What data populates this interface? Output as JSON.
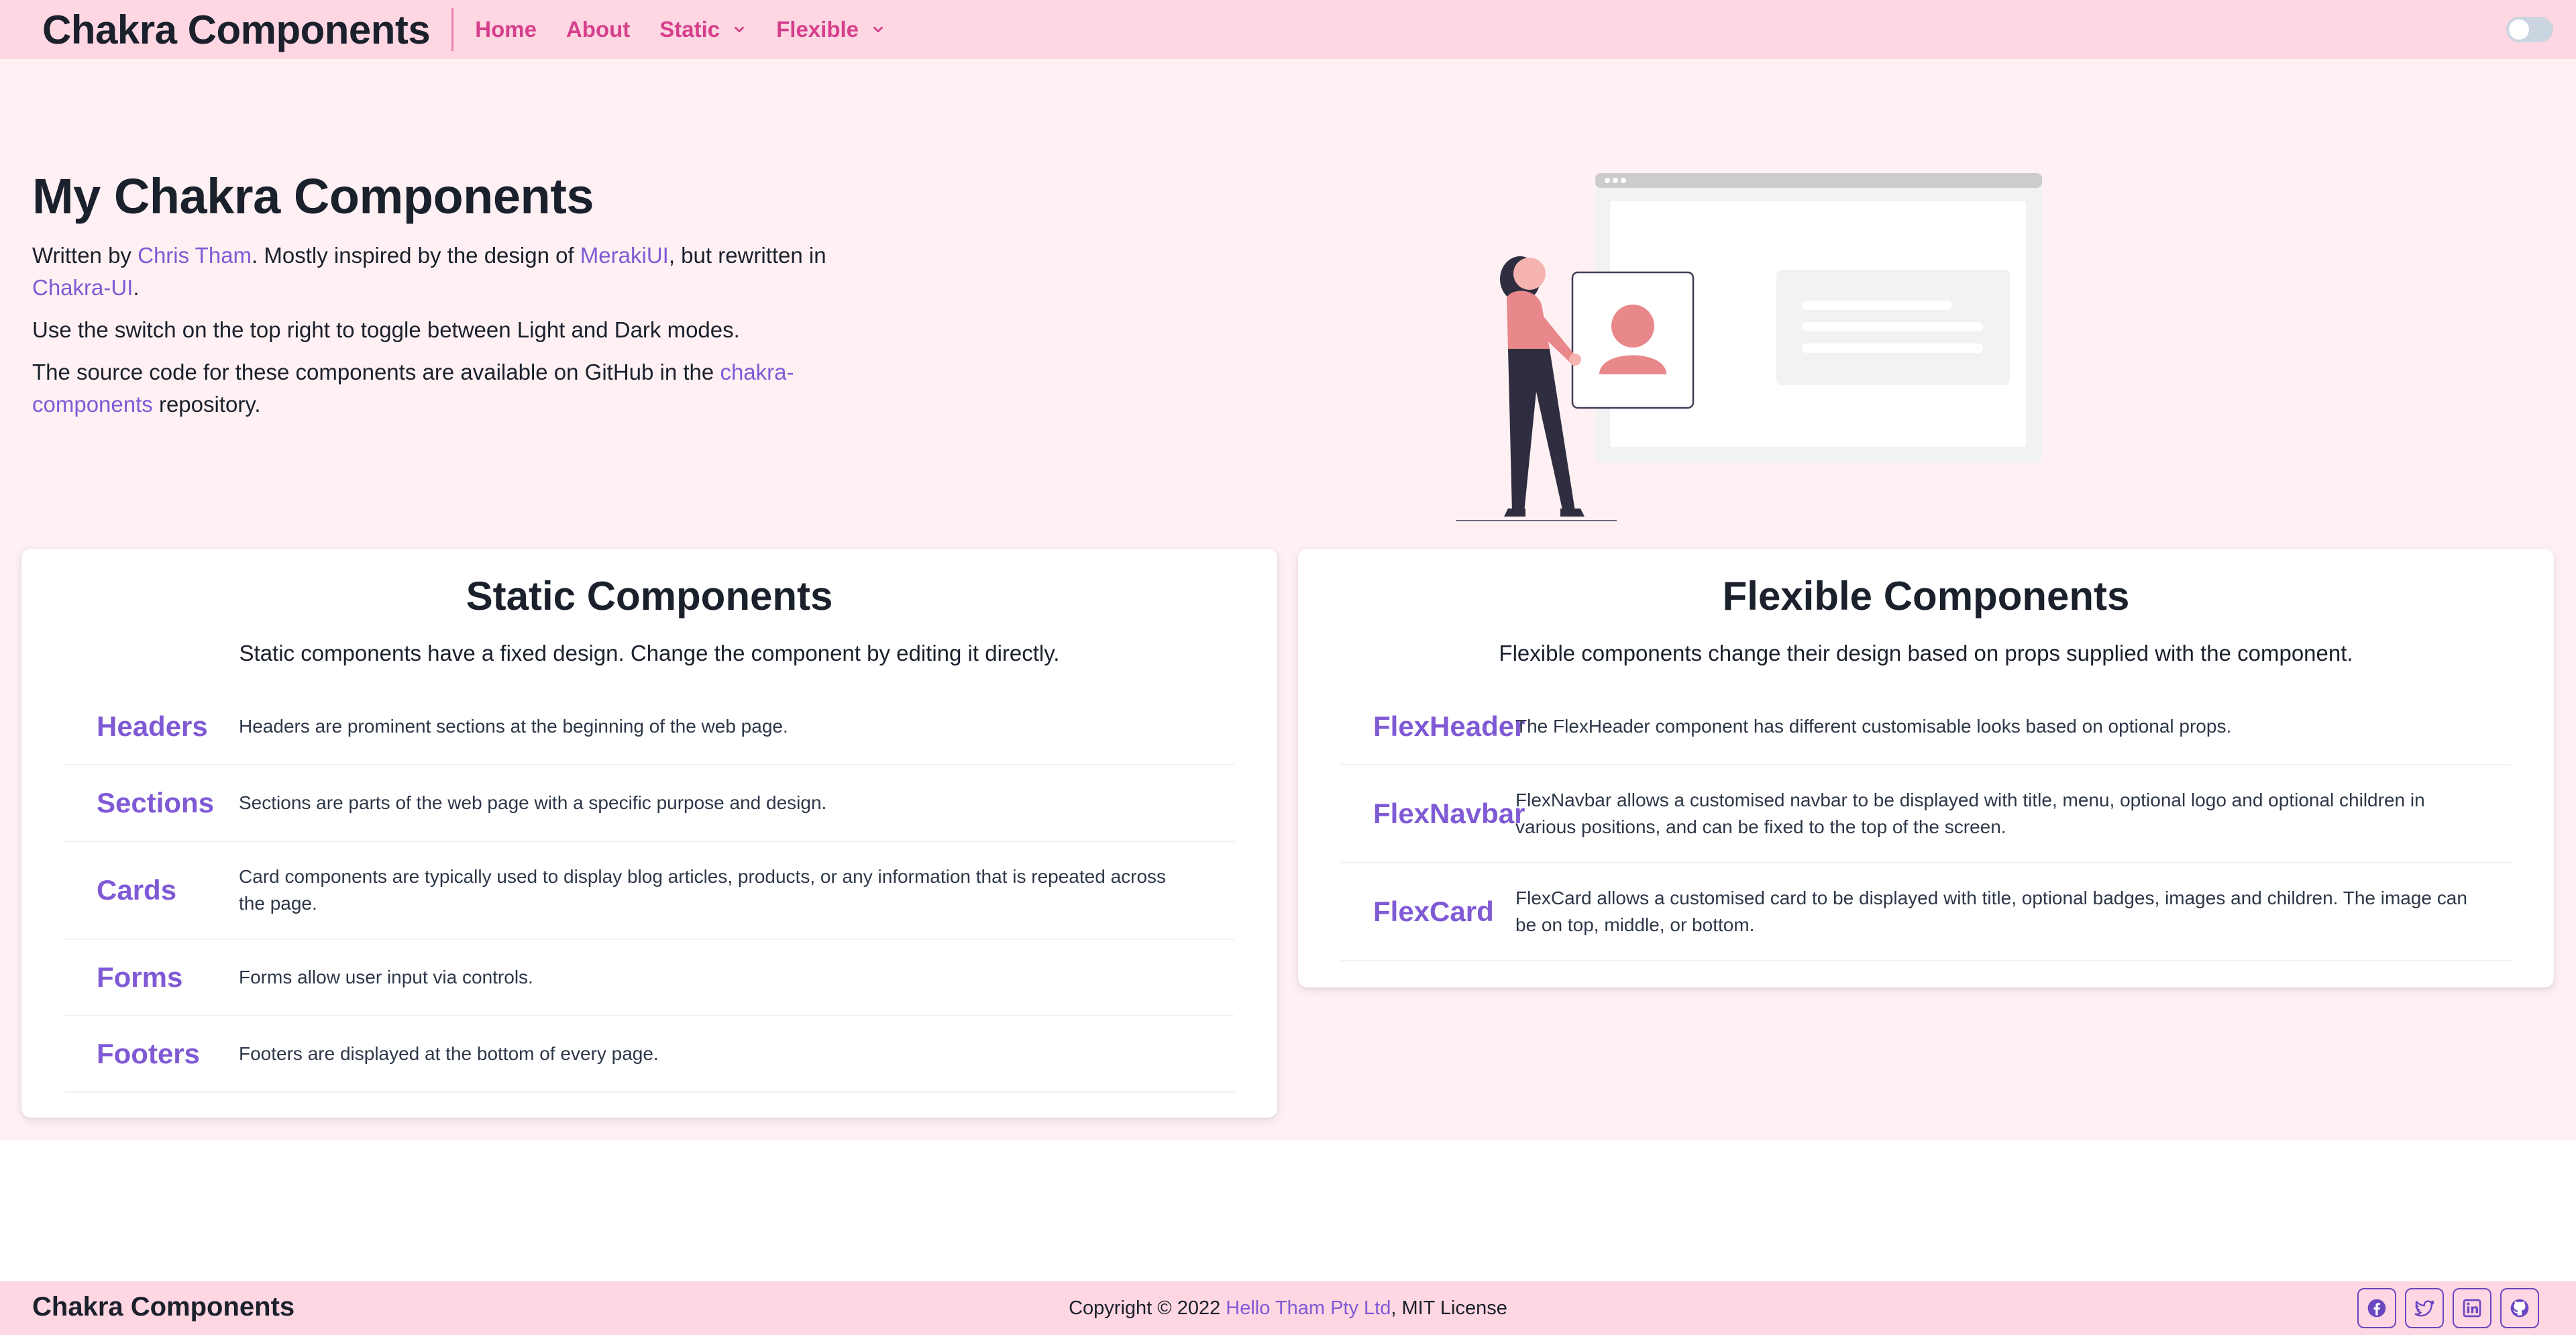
{
  "navbar": {
    "brand": "Chakra Components",
    "links": [
      {
        "label": "Home"
      },
      {
        "label": "About"
      },
      {
        "label": "Static"
      },
      {
        "label": "Flexible"
      }
    ]
  },
  "hero": {
    "title": "My Chakra Components",
    "p1": {
      "t1": "Written by ",
      "author": "Chris Tham",
      "t2": ". Mostly inspired by the design of ",
      "meraki": "MerakiUI",
      "t3": ", but rewritten in ",
      "chakra": "Chakra-UI",
      "t4": "."
    },
    "p2": "Use the switch on the top right to toggle between Light and Dark modes.",
    "p3": {
      "t1": "The source code for these components are available on GitHub in the ",
      "repo": "chakra-components",
      "t2": " repository."
    }
  },
  "static_card": {
    "title": "Static Components",
    "subtitle": "Static components have a fixed design. Change the component by editing it directly.",
    "items": [
      {
        "label": "Headers",
        "desc": "Headers are prominent sections at the beginning of the web page."
      },
      {
        "label": "Sections",
        "desc": "Sections are parts of the web page with a specific purpose and design."
      },
      {
        "label": "Cards",
        "desc": "Card components are typically used to display blog articles, products, or any information that is repeated across the page."
      },
      {
        "label": "Forms",
        "desc": "Forms allow user input via controls."
      },
      {
        "label": "Footers",
        "desc": "Footers are displayed at the bottom of every page."
      }
    ]
  },
  "flex_card": {
    "title": "Flexible Components",
    "subtitle": "Flexible components change their design based on props supplied with the component.",
    "items": [
      {
        "label": "FlexHeader",
        "desc": "The FlexHeader component has different customisable looks based on optional props."
      },
      {
        "label": "FlexNavbar",
        "desc": "FlexNavbar allows a customised navbar to be displayed with title, menu, optional logo and optional children in various positions, and can be fixed to the top of the screen."
      },
      {
        "label": "FlexCard",
        "desc": "FlexCard allows a customised card to be displayed with title, optional badges, images and children. The image can be on top, middle, or bottom."
      }
    ]
  },
  "footer": {
    "brand": "Chakra Components",
    "copy_t1": "Copyright © 2022 ",
    "company": "Hello Tham Pty Ltd",
    "copy_t2": ", MIT License",
    "social": [
      "facebook-icon",
      "twitter-icon",
      "linkedin-icon",
      "github-icon"
    ]
  },
  "colors": {
    "navbar_bg": "#fed7e2",
    "page_bg": "#fff1f3",
    "nav_link": "#d53f8c",
    "accent": "#805ad5"
  }
}
